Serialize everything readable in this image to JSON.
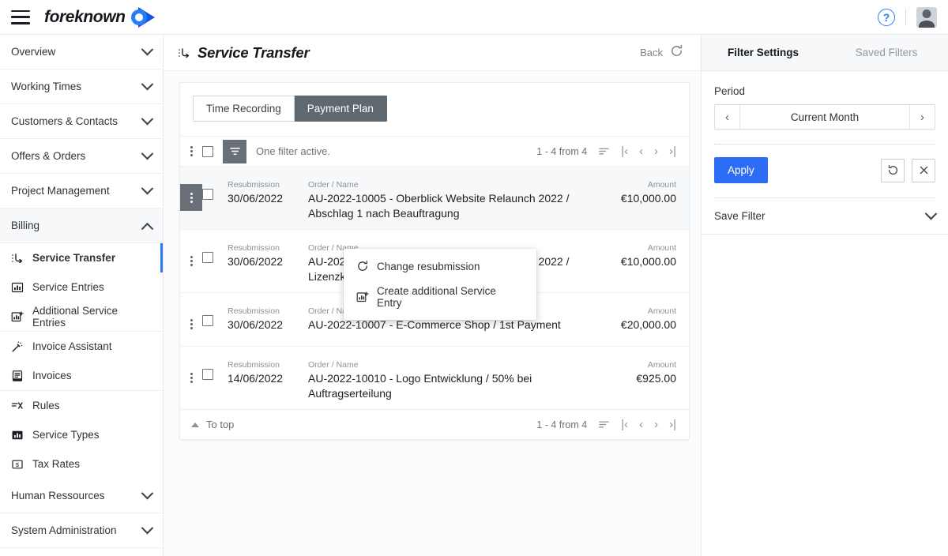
{
  "topbar": {
    "menu_icon": "hamburger-icon",
    "brand_name": "foreknown",
    "help_icon": "question-mark-icon",
    "avatar_icon": "user-avatar"
  },
  "sidebar": {
    "groups": [
      {
        "label": "Overview",
        "expanded": false
      },
      {
        "label": "Working Times",
        "expanded": false
      },
      {
        "label": "Customers & Contacts",
        "expanded": false
      },
      {
        "label": "Offers & Orders",
        "expanded": false
      },
      {
        "label": "Project Management",
        "expanded": false
      },
      {
        "label": "Billing",
        "expanded": true
      },
      {
        "label": "Human Ressources",
        "expanded": false
      },
      {
        "label": "System Administration",
        "expanded": false
      }
    ],
    "billing_items": [
      {
        "label": "Service Transfer",
        "icon": "service-transfer-icon",
        "active": true
      },
      {
        "label": "Service Entries",
        "icon": "bar-chart-icon",
        "active": false
      },
      {
        "label": "Additional Service Entries",
        "icon": "bar-chart-plus-icon",
        "active": false
      },
      {
        "label": "Invoice Assistant",
        "icon": "magic-wand-icon",
        "active": false
      },
      {
        "label": "Invoices",
        "icon": "invoice-document-icon",
        "active": false
      },
      {
        "label": "Rules",
        "icon": "rules-icon",
        "active": false
      },
      {
        "label": "Service Types",
        "icon": "bar-chart-filled-icon",
        "active": false
      },
      {
        "label": "Tax Rates",
        "icon": "money-bill-icon",
        "active": false
      }
    ]
  },
  "page": {
    "title": "Service Transfer",
    "title_icon": "service-transfer-icon",
    "back_label": "Back",
    "refresh_icon": "refresh-icon"
  },
  "tabs": {
    "time_recording": "Time Recording",
    "payment_plan": "Payment Plan",
    "selected": "Payment Plan"
  },
  "toolbar": {
    "kebab_icon": "more-options-icon",
    "select_all_checkbox": "select-all-checkbox",
    "filter_icon": "filter-icon",
    "status_text": "One filter active.",
    "pagination_count": "1 - 4 from 4",
    "sort_icon": "sort-icon",
    "first_page_icon": "first-page-icon",
    "prev_page_icon": "previous-page-icon",
    "next_page_icon": "next-page-icon",
    "last_page_icon": "last-page-icon"
  },
  "table": {
    "headers": {
      "resubmission": "Resubmission",
      "order_name": "Order / Name",
      "amount": "Amount"
    },
    "rows": [
      {
        "resubmission": "30/06/2022",
        "order_name": "AU-2022-10005 - Oberblick Website Relaunch 2022 / Abschlag 1 nach Beauftragung",
        "amount": "€10,000.00"
      },
      {
        "resubmission": "30/06/2022",
        "order_name": "AU-2022-10005 - Oberblick Website Relaunch 2022 / Lizenzkosten",
        "amount": "€10,000.00"
      },
      {
        "resubmission": "30/06/2022",
        "order_name": "AU-2022-10007 - E-Commerce Shop / 1st Payment",
        "amount": "€20,000.00"
      },
      {
        "resubmission": "14/06/2022",
        "order_name": "AU-2022-10010 - Logo Entwicklung / 50% bei Auftragserteilung",
        "amount": "€925.00"
      }
    ]
  },
  "context_menu": {
    "items": [
      {
        "label": "Change resubmission",
        "icon": "change-resubmission-icon"
      },
      {
        "label": "Create additional Service Entry",
        "icon": "create-service-entry-icon"
      }
    ]
  },
  "footer": {
    "to_top": "To top",
    "to_top_icon": "caret-up-icon",
    "pagination_count": "1 - 4 from 4"
  },
  "filter_panel": {
    "tab_settings": "Filter Settings",
    "tab_saved": "Saved Filters",
    "period_label": "Period",
    "period_value": "Current Month",
    "period_prev_icon": "chevron-left-icon",
    "period_next_icon": "chevron-right-icon",
    "apply_label": "Apply",
    "reset_icon": "reset-icon",
    "clear_icon": "clear-x-icon",
    "save_filter_label": "Save Filter",
    "save_filter_chevron": "chevron-down-icon"
  },
  "colors": {
    "accent_blue": "#2d6df6",
    "brand_blue": "#1452e8",
    "selected_gray": "#697078",
    "segment_active": "#60686f"
  }
}
